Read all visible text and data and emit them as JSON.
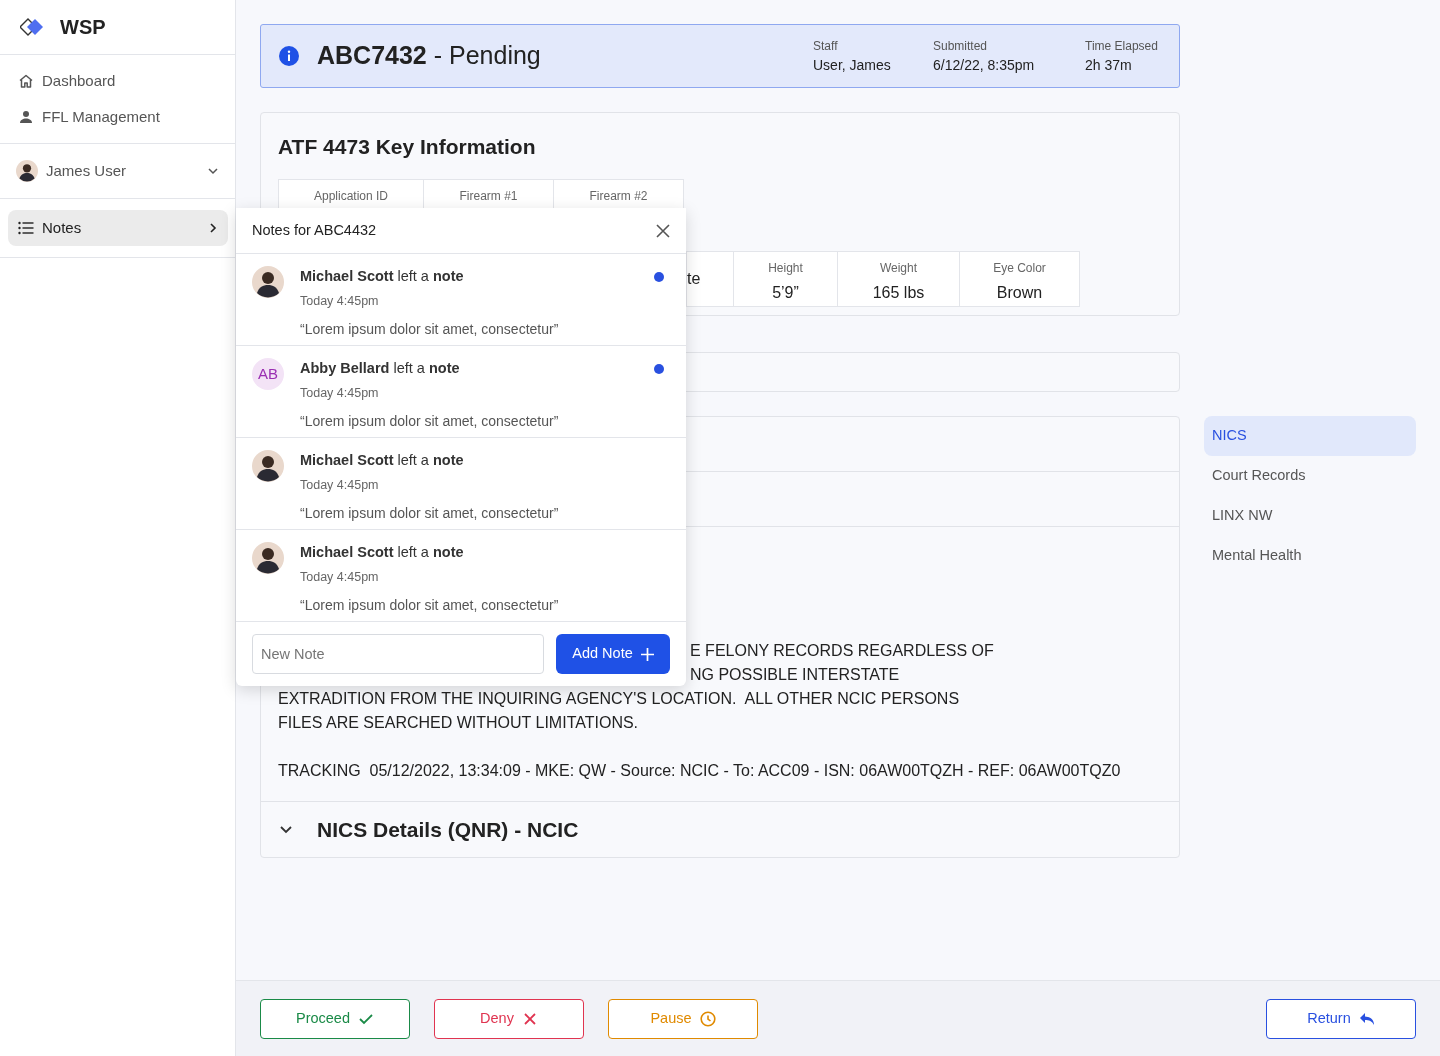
{
  "sidebar": {
    "brand": "WSP",
    "nav": [
      {
        "label": "Dashboard"
      },
      {
        "label": "FFL Management"
      }
    ],
    "user": {
      "name": "James User",
      "expanded": false
    },
    "notes_item": {
      "label": "Notes",
      "selected": true
    }
  },
  "header": {
    "case_id": "ABC7432",
    "status": "- Pending",
    "meta": [
      {
        "label": "Staff",
        "value": "User, James"
      },
      {
        "label": "Submitted",
        "value": "6/12/22, 8:35pm"
      },
      {
        "label": "Time Elapsed",
        "value": "2h 37m"
      }
    ]
  },
  "key_info": {
    "title": "ATF 4473 Key Information",
    "row_1": [
      {
        "label": "Application ID"
      },
      {
        "label": "Firearm #1"
      },
      {
        "label": "Firearm #2"
      }
    ],
    "row_2": [
      {
        "value": "te"
      },
      {
        "label": "Height",
        "value": "5’9”"
      },
      {
        "label": "Weight",
        "value": "165 lbs"
      },
      {
        "label": "Eye Color",
        "value": "Brown"
      }
    ]
  },
  "record": {
    "lines": [
      "E FELONY RECORDS REGARDLESS OF",
      "NG POSSIBLE INTERSTATE",
      "EXTRADITION FROM THE INQUIRING AGENCY'S LOCATION.  ALL OTHER NCIC PERSONS",
      "FILES ARE SEARCHED WITHOUT LIMITATIONS."
    ],
    "tracking": "TRACKING  05/12/2022, 13:34:09 - MKE: QW - Source: NCIC - To: ACC09 - ISN: 06AW00TQZH - REF: 06AW00TQZ0"
  },
  "accordion": {
    "title": "NICS Details (QNR) - NCIC",
    "expanded": false
  },
  "side_tabs": [
    {
      "label": "NICS",
      "selected": true
    },
    {
      "label": "Court Records",
      "selected": false
    },
    {
      "label": "LINX NW",
      "selected": false
    },
    {
      "label": "Mental Health",
      "selected": false
    }
  ],
  "notes_popover": {
    "title": "Notes for ABC4432",
    "notes": [
      {
        "kind": "photo",
        "heading": "**Michael Scott** left a **note**",
        "time": "Today 4:45pm",
        "text": "“Lorem ipsum dolor sit amet, consectetur”",
        "unread": true
      },
      {
        "kind": "initials",
        "initials": "AB",
        "heading": "**Abby Bellard** left a **note**",
        "time": "Today 4:45pm",
        "text": "“Lorem ipsum dolor sit amet, consectetur”",
        "unread": true
      },
      {
        "kind": "photo",
        "heading": "**Michael Scott** left a **note**",
        "time": "Today 4:45pm",
        "text": "“Lorem ipsum dolor sit amet, consectetur”",
        "unread": false
      },
      {
        "kind": "photo",
        "heading": "**Michael Scott** left a **note**",
        "time": "Today 4:45pm",
        "text": "“Lorem ipsum dolor sit amet, consectetur”",
        "unread": false
      }
    ],
    "new_note": {
      "placeholder": "New Note"
    },
    "add_button": "Add Note"
  },
  "actions": [
    {
      "label": "Proceed",
      "kind": "proceed"
    },
    {
      "label": "Deny",
      "kind": "deny"
    },
    {
      "label": "Pause",
      "kind": "pause"
    }
  ],
  "return_button": "Return"
}
